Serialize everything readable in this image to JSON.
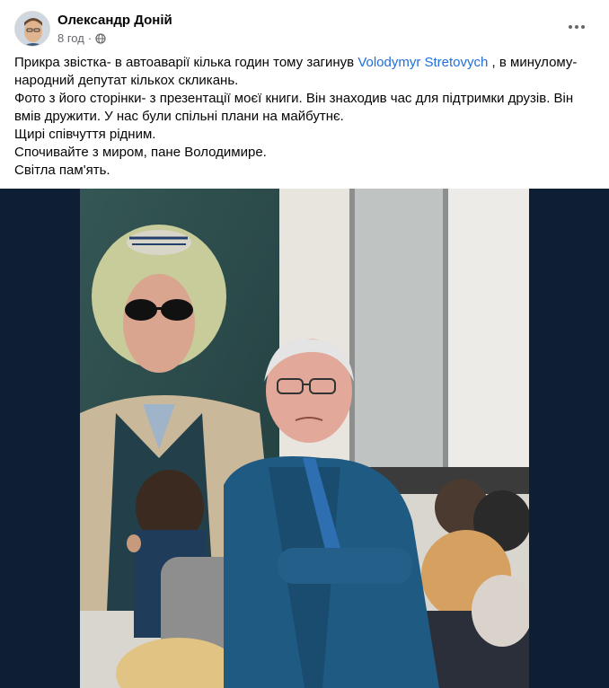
{
  "post": {
    "author": "Олександр Доній",
    "time": "8 год",
    "separator": "·",
    "privacy_icon": "globe-icon",
    "more_icon": "more-horizontal-icon",
    "text": {
      "line1_before": "Прикра звістка- в автоаварії кілька годин тому загинув ",
      "mention": "Volodymyr Stretovych",
      "line1_after": " , в минулому-народний депутат кількох скликань.",
      "line2": "Фото з його сторінки- з презентації моєї книги. Він знаходив час для підтримки друзів. Він вмів дружити. У нас були спільні плани на майбутнє.",
      "line3": "Щирі співчуття рідним.",
      "line4": "Спочивайте з миром, пане Володимире.",
      "line5": "Світла пам'ять."
    }
  },
  "colors": {
    "link": "#216fdb",
    "meta_gray": "#65676b",
    "photo_bg": "#0f1f33"
  }
}
